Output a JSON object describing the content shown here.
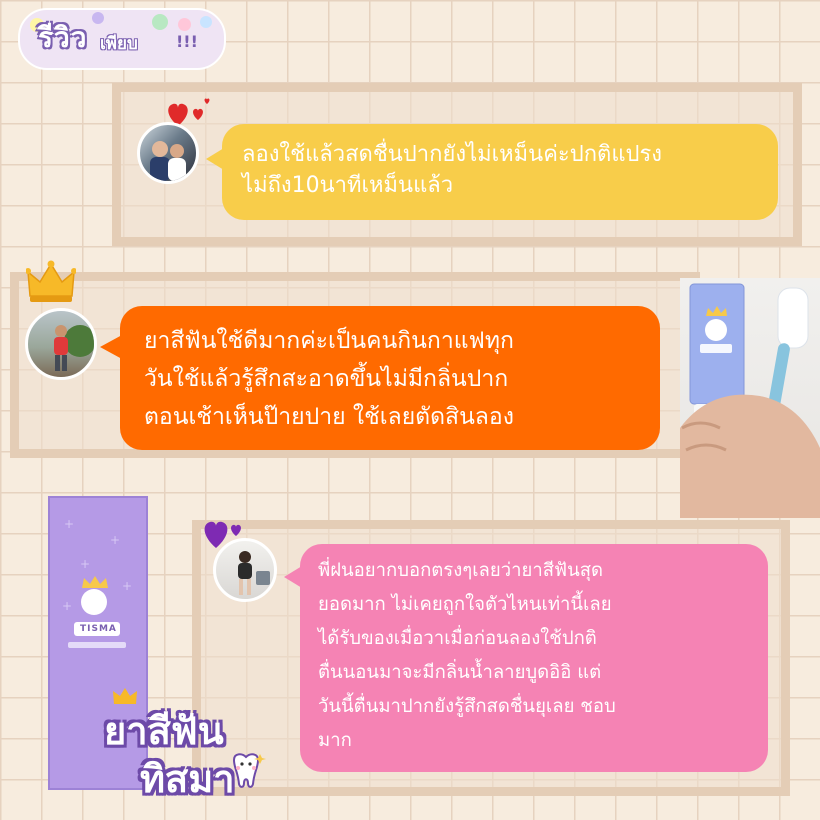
{
  "header": {
    "title": "รีวิว",
    "subtitle": "เพียบ",
    "exclaim": "!!!"
  },
  "reviews": [
    {
      "text_line1": "ลองใช้แล้วสดชื่นปากยังไม่เหม็นค่ะปกติแปรง",
      "text_line2": "ไม่ถึง10นาทีเหม็นแล้ว",
      "bubble_color": "#f8cd4a",
      "text_color": "#ffffff"
    },
    {
      "text_line1": "ยาสีฟันใช้ดีมากค่ะเป็นคนกินกาแฟทุก",
      "text_line2": "วันใช้แล้วรู้สึกสะอาดขึ้นไม่มีกลิ่นปาก",
      "text_line3": "ตอนเช้าเห็นป๊ายปาย ใช้เลยตัดสินลอง",
      "bubble_color": "#ff6a00",
      "text_color": "#ffffff"
    },
    {
      "text_line1": "พี่ฝนอยากบอกตรงๆเลยว่ายาสีฟันสุด",
      "text_line2": "ยอดมาก ไม่เคยถูกใจตัวไหนเท่านี้เลย",
      "text_line3": "ได้รับของเมื่อวาเมื่อก่อนลองใช้ปกติ",
      "text_line4": "ตื่นนอนมาจะมีกลิ่นน้ำลายบูดอิอิ แต่",
      "text_line5": "วันนี้ตื่นมาปากยังรู้สึกสดชื่นยุเลย ชอบ",
      "text_line6": "มาก",
      "bubble_color": "#f583b4",
      "text_color": "#ffffff"
    }
  ],
  "product": {
    "brand": "TISMA",
    "line1": "ยาสีฟัน",
    "line2": "ทิสมา"
  },
  "colors": {
    "accent_purple": "#7a5fb0",
    "card_border": "#e4cdb6",
    "grid_line": "#e6d2bf",
    "background": "#f7ecde"
  },
  "icons": [
    "heart-icon",
    "crown-icon",
    "tooth-icon"
  ]
}
